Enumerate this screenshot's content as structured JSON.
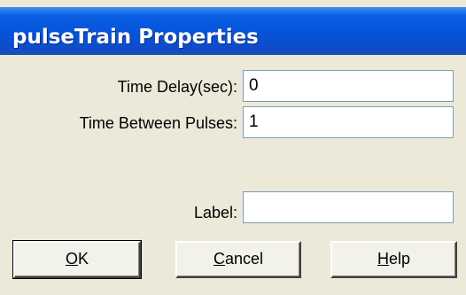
{
  "window": {
    "title": "pulseTrain Properties"
  },
  "fields": {
    "time_delay": {
      "label": "Time Delay(sec):",
      "value": "0"
    },
    "time_between": {
      "label": "Time Between Pulses:",
      "value": "1"
    },
    "label_field": {
      "label": "Label:",
      "value": ""
    }
  },
  "buttons": {
    "ok": {
      "mnemonic": "O",
      "rest": "K"
    },
    "cancel": {
      "mnemonic": "C",
      "rest": "ancel"
    },
    "help": {
      "mnemonic": "H",
      "rest": "elp"
    }
  }
}
